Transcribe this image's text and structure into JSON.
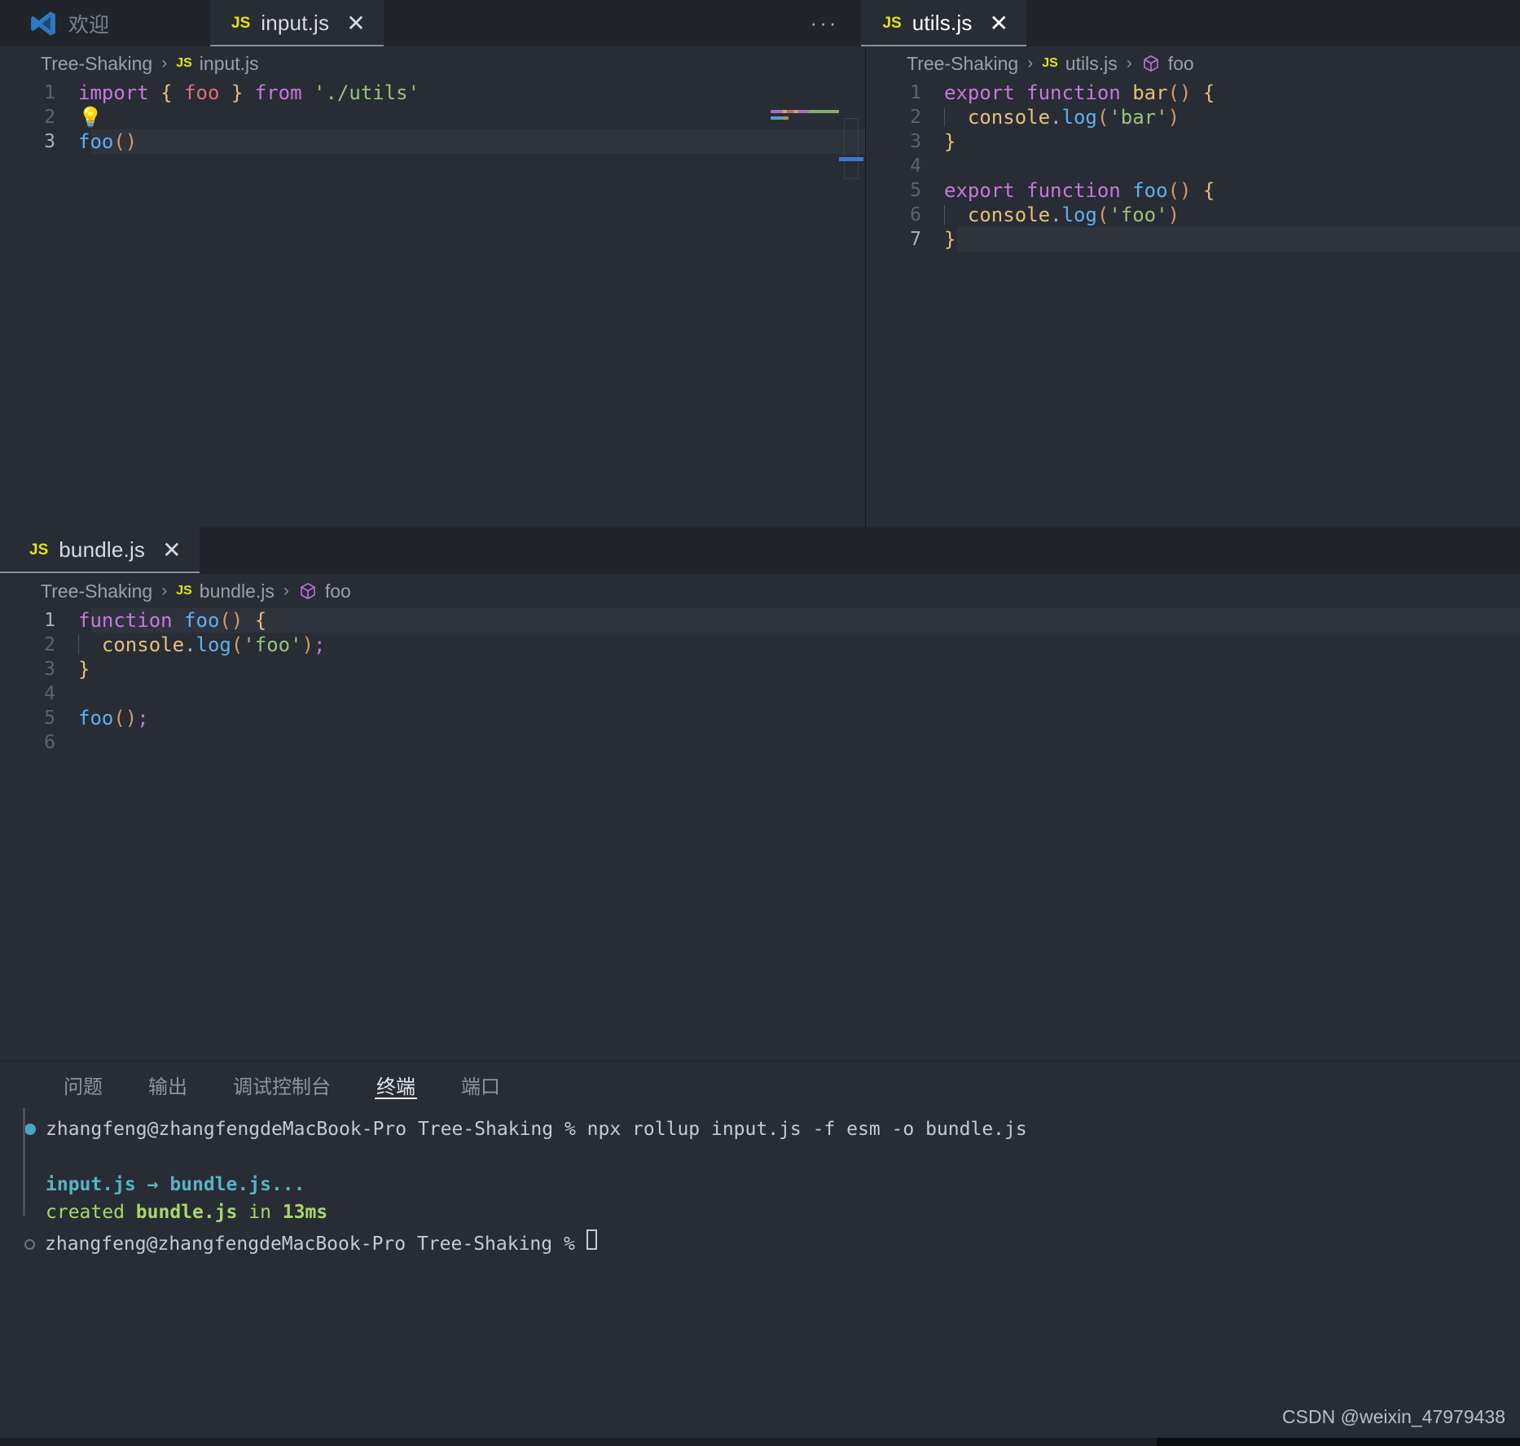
{
  "window": {
    "welcome_tab_label": "欢迎",
    "vscode_logo_icon": "vscode-logo-icon"
  },
  "top_tabs": [
    {
      "badge": "JS",
      "name": "input.js",
      "close": "✕",
      "active": true
    },
    {
      "badge": "JS",
      "name": "utils.js",
      "close": "✕",
      "active": true
    }
  ],
  "tab_overflow": "···",
  "editor_left": {
    "breadcrumb": {
      "project": "Tree-Shaking",
      "sep": "›",
      "badge": "JS",
      "file": "input.js"
    },
    "lines": [
      {
        "n": "1",
        "tokens": [
          {
            "t": "import",
            "c": "k"
          },
          {
            "t": " ",
            "c": "p"
          },
          {
            "t": "{",
            "c": "b"
          },
          {
            "t": " ",
            "c": "p"
          },
          {
            "t": "foo",
            "c": "v"
          },
          {
            "t": " ",
            "c": "p"
          },
          {
            "t": "}",
            "c": "b"
          },
          {
            "t": " ",
            "c": "p"
          },
          {
            "t": "from",
            "c": "k"
          },
          {
            "t": " ",
            "c": "p"
          },
          {
            "t": "'./utils'",
            "c": "s"
          }
        ]
      },
      {
        "n": "2",
        "bulb": "💡",
        "tokens": []
      },
      {
        "n": "3",
        "highlight": true,
        "current": true,
        "tokens": [
          {
            "t": "foo",
            "c": "f"
          },
          {
            "t": "()",
            "c": "o"
          }
        ]
      }
    ],
    "minimap_icon": "minimap",
    "minimap_preview": [
      "import { foo } from './utils'",
      "foo()"
    ]
  },
  "editor_right": {
    "breadcrumb": {
      "project": "Tree-Shaking",
      "sep": "›",
      "badge": "JS",
      "file": "utils.js",
      "symbol": "foo",
      "symbol_icon": "cube-icon"
    },
    "lines": [
      {
        "n": "1",
        "tokens": [
          {
            "t": "export",
            "c": "k"
          },
          {
            "t": " ",
            "c": "p"
          },
          {
            "t": "function",
            "c": "k"
          },
          {
            "t": " ",
            "c": "p"
          },
          {
            "t": "bar",
            "c": "e5c07b"
          },
          {
            "t": "()",
            "c": "o"
          },
          {
            "t": " ",
            "c": "p"
          },
          {
            "t": "{",
            "c": "b"
          }
        ]
      },
      {
        "n": "2",
        "guide": true,
        "tokens": [
          {
            "t": "  ",
            "c": "p"
          },
          {
            "t": "console",
            "c": "b"
          },
          {
            "t": ".",
            "c": "p"
          },
          {
            "t": "log",
            "c": "f"
          },
          {
            "t": "(",
            "c": "o"
          },
          {
            "t": "'bar'",
            "c": "s"
          },
          {
            "t": ")",
            "c": "o"
          }
        ]
      },
      {
        "n": "3",
        "tokens": [
          {
            "t": "}",
            "c": "b"
          }
        ]
      },
      {
        "n": "4",
        "tokens": []
      },
      {
        "n": "5",
        "tokens": [
          {
            "t": "export",
            "c": "k"
          },
          {
            "t": " ",
            "c": "p"
          },
          {
            "t": "function",
            "c": "k"
          },
          {
            "t": " ",
            "c": "p"
          },
          {
            "t": "foo",
            "c": "f"
          },
          {
            "t": "()",
            "c": "o"
          },
          {
            "t": " ",
            "c": "p"
          },
          {
            "t": "{",
            "c": "b"
          }
        ]
      },
      {
        "n": "6",
        "guide": true,
        "tokens": [
          {
            "t": "  ",
            "c": "p"
          },
          {
            "t": "console",
            "c": "b"
          },
          {
            "t": ".",
            "c": "p"
          },
          {
            "t": "log",
            "c": "f"
          },
          {
            "t": "(",
            "c": "o"
          },
          {
            "t": "'foo'",
            "c": "s"
          },
          {
            "t": ")",
            "c": "o"
          }
        ]
      },
      {
        "n": "7",
        "highlight": true,
        "current": true,
        "tokens": [
          {
            "t": "}",
            "c": "b"
          }
        ]
      }
    ]
  },
  "bundle_editor": {
    "tab": {
      "badge": "JS",
      "name": "bundle.js",
      "close": "✕"
    },
    "breadcrumb": {
      "project": "Tree-Shaking",
      "sep": "›",
      "badge": "JS",
      "file": "bundle.js",
      "symbol": "foo",
      "symbol_icon": "cube-icon"
    },
    "lines": [
      {
        "n": "1",
        "highlight": true,
        "current": true,
        "tokens": [
          {
            "t": "function",
            "c": "k"
          },
          {
            "t": " ",
            "c": "p"
          },
          {
            "t": "foo",
            "c": "f"
          },
          {
            "t": "()",
            "c": "o"
          },
          {
            "t": " ",
            "c": "p"
          },
          {
            "t": "{",
            "c": "b"
          }
        ]
      },
      {
        "n": "2",
        "guide": true,
        "tokens": [
          {
            "t": "  ",
            "c": "p"
          },
          {
            "t": "console",
            "c": "b"
          },
          {
            "t": ".",
            "c": "p"
          },
          {
            "t": "log",
            "c": "f"
          },
          {
            "t": "(",
            "c": "o"
          },
          {
            "t": "'foo'",
            "c": "s"
          },
          {
            "t": ")",
            "c": "o"
          },
          {
            "t": ";",
            "c": "k"
          }
        ]
      },
      {
        "n": "3",
        "tokens": [
          {
            "t": "}",
            "c": "b"
          }
        ]
      },
      {
        "n": "4",
        "tokens": []
      },
      {
        "n": "5",
        "tokens": [
          {
            "t": "foo",
            "c": "f"
          },
          {
            "t": "()",
            "c": "o"
          },
          {
            "t": ";",
            "c": "k"
          }
        ]
      },
      {
        "n": "6",
        "tokens": []
      }
    ]
  },
  "panel": {
    "tabs": [
      {
        "label": "问题",
        "active": false
      },
      {
        "label": "输出",
        "active": false
      },
      {
        "label": "调试控制台",
        "active": false
      },
      {
        "label": "终端",
        "active": true
      },
      {
        "label": "端口",
        "active": false
      }
    ],
    "terminal": {
      "prompt_1": "zhangfeng@zhangfengdeMacBook-Pro Tree-Shaking % ",
      "command": "npx rollup input.js -f esm -o bundle.js",
      "out_line_1": "input.js → bundle.js...",
      "out_created": "created ",
      "out_bundle": "bundle.js",
      "out_in": " in ",
      "out_time": "13ms",
      "prompt_2": "zhangfeng@zhangfengdeMacBook-Pro Tree-Shaking % "
    }
  },
  "watermark": "CSDN @weixin_47979438",
  "colors": {
    "editor_bg": "#282c34",
    "tabbar_bg": "#21252b",
    "accent_blue": "#3b74d8",
    "keyword": "#c678dd",
    "string": "#98c379",
    "function": "#61afef",
    "variable": "#e06c75",
    "gold": "#e5c07b",
    "orange": "#d19a66"
  }
}
